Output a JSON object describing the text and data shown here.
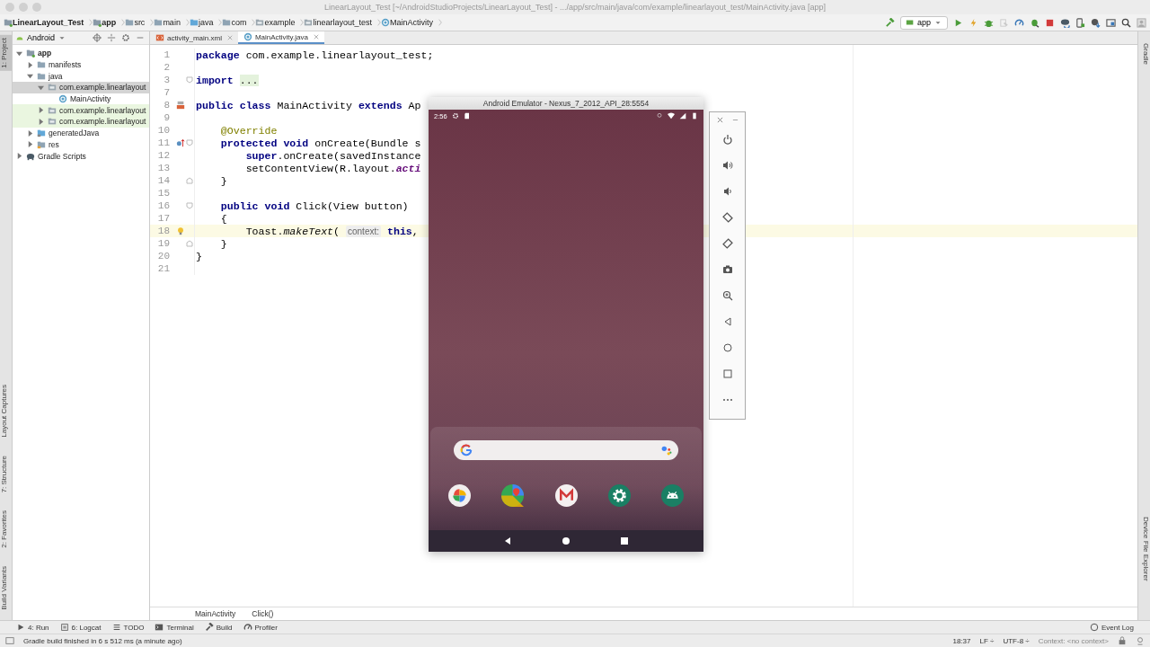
{
  "window": {
    "title": "LinearLayout_Test [~/AndroidStudioProjects/LinearLayout_Test] - .../app/src/main/java/com/example/linearlayout_test/MainActivity.java [app]"
  },
  "breadcrumbs": [
    {
      "label": "LinearLayout_Test",
      "kind": "module",
      "bold": true
    },
    {
      "label": "app",
      "kind": "module",
      "bold": true
    },
    {
      "label": "src",
      "kind": "folder",
      "bold": false
    },
    {
      "label": "main",
      "kind": "folder",
      "bold": false
    },
    {
      "label": "java",
      "kind": "source",
      "bold": false
    },
    {
      "label": "com",
      "kind": "folder",
      "bold": false
    },
    {
      "label": "example",
      "kind": "package",
      "bold": false
    },
    {
      "label": "linearlayout_test",
      "kind": "package",
      "bold": false
    },
    {
      "label": "MainActivity",
      "kind": "class",
      "bold": false
    }
  ],
  "toolbar": {
    "run_config": "app",
    "buttons": [
      {
        "kind": "hammer",
        "disabled": false
      },
      {
        "kind": "run",
        "disabled": false
      },
      {
        "kind": "apply",
        "disabled": false
      },
      {
        "kind": "debug",
        "disabled": false
      },
      {
        "kind": "attach",
        "disabled": true
      },
      {
        "kind": "profile",
        "disabled": false
      },
      {
        "kind": "debugattach",
        "disabled": false
      },
      {
        "kind": "stop",
        "disabled": false
      },
      {
        "kind": "sync",
        "disabled": false
      },
      {
        "kind": "avd",
        "disabled": false
      },
      {
        "kind": "sdk",
        "disabled": false
      },
      {
        "kind": "structure",
        "disabled": false
      },
      {
        "kind": "search",
        "disabled": false
      },
      {
        "kind": "account",
        "disabled": false
      }
    ]
  },
  "left_stripe": {
    "top": [
      {
        "label": "1: Project",
        "selected": true
      }
    ],
    "bottom": [
      {
        "label": "Layout Captures",
        "selected": false
      },
      {
        "label": "7: Structure",
        "selected": false
      },
      {
        "label": "2: Favorites",
        "selected": false
      },
      {
        "label": "Build Variants",
        "selected": false
      }
    ]
  },
  "right_stripe": {
    "top": [
      {
        "label": "Gradle"
      }
    ],
    "bottom": [
      {
        "label": "Device File Explorer"
      }
    ]
  },
  "project": {
    "view": "Android",
    "tree": [
      {
        "label": "app",
        "kind": "module",
        "bold": true,
        "expanded": true,
        "selected": false,
        "tinted": false,
        "children": [
          {
            "label": "manifests",
            "kind": "folder",
            "bold": false,
            "expanded": false,
            "selected": false,
            "tinted": false
          },
          {
            "label": "java",
            "kind": "folder",
            "bold": false,
            "expanded": true,
            "selected": false,
            "tinted": false,
            "children": [
              {
                "label": "com.example.linearlayout",
                "kind": "package",
                "bold": false,
                "expanded": true,
                "selected": true,
                "tinted": false,
                "children": [
                  {
                    "label": "MainActivity",
                    "kind": "class",
                    "bold": false,
                    "selected": false,
                    "tinted": false
                  }
                ]
              },
              {
                "label": "com.example.linearlayout",
                "kind": "package",
                "bold": false,
                "expanded": false,
                "selected": false,
                "tinted": true
              },
              {
                "label": "com.example.linearlayout",
                "kind": "package",
                "bold": false,
                "expanded": false,
                "selected": false,
                "tinted": true
              }
            ]
          },
          {
            "label": "generatedJava",
            "kind": "generated",
            "bold": false,
            "expanded": false,
            "selected": false,
            "tinted": false
          },
          {
            "label": "res",
            "kind": "res",
            "bold": false,
            "expanded": false,
            "selected": false,
            "tinted": false
          }
        ]
      },
      {
        "label": "Gradle Scripts",
        "kind": "gradle",
        "bold": false,
        "expanded": false,
        "selected": false,
        "tinted": false
      }
    ]
  },
  "editor": {
    "tabs": [
      {
        "label": "activity_main.xml",
        "kind": "xml",
        "selected": false
      },
      {
        "label": "MainActivity.java",
        "kind": "class",
        "selected": true
      }
    ],
    "lines": [
      {
        "number": "1",
        "segments": [
          {
            "text": "package",
            "kind": "keyword"
          },
          {
            "text": " com.example.linearlayout_test;",
            "kind": "plain"
          }
        ]
      },
      {
        "number": "2"
      },
      {
        "number": "3",
        "fold": {
          "kind": "start"
        },
        "segments": [
          {
            "text": "import ",
            "kind": "keyword"
          },
          {
            "text": "...",
            "kind": "folded"
          }
        ]
      },
      {
        "number": "7"
      },
      {
        "number": "8",
        "marker": {
          "kind": "layout"
        },
        "segments": [
          {
            "text": "public class",
            "kind": "keyword"
          },
          {
            "text": " MainActivity ",
            "kind": "plain"
          },
          {
            "text": "extends",
            "kind": "keyword"
          },
          {
            "text": " Ap",
            "kind": "plain"
          }
        ]
      },
      {
        "number": "9"
      },
      {
        "number": "10",
        "segments": [
          {
            "text": "    @Override",
            "kind": "annotation"
          }
        ]
      },
      {
        "number": "11",
        "marker": {
          "kind": "override"
        },
        "fold": {
          "kind": "start"
        },
        "segments": [
          {
            "text": "    protected void",
            "kind": "keyword"
          },
          {
            "text": " onCreate(Bundle s",
            "kind": "plain"
          }
        ]
      },
      {
        "number": "12",
        "segments": [
          {
            "text": "        super",
            "kind": "keyword"
          },
          {
            "text": ".onCreate(savedInstance",
            "kind": "plain"
          }
        ]
      },
      {
        "number": "13",
        "segments": [
          {
            "text": "        setContentView(R.layout.",
            "kind": "plain"
          },
          {
            "text": "acti",
            "kind": "field"
          }
        ]
      },
      {
        "number": "14",
        "fold": {
          "kind": "end"
        },
        "segments": [
          {
            "text": "    }",
            "kind": "plain"
          }
        ]
      },
      {
        "number": "15"
      },
      {
        "number": "16",
        "fold": {
          "kind": "start"
        },
        "segments": [
          {
            "text": "    public void",
            "kind": "keyword"
          },
          {
            "text": " Click(View button)",
            "kind": "plain"
          }
        ]
      },
      {
        "number": "17",
        "segments": [
          {
            "text": "    {",
            "kind": "plain"
          }
        ]
      },
      {
        "number": "18",
        "marker": {
          "kind": "bulb"
        },
        "highlighted": true,
        "segments": [
          {
            "text": "        Toast.",
            "kind": "plain"
          },
          {
            "text": "makeText",
            "kind": "italic"
          },
          {
            "text": "( ",
            "kind": "plain"
          },
          {
            "text": "context:",
            "kind": "hint"
          },
          {
            "text": " this",
            "kind": "keyword"
          },
          {
            "text": ",",
            "kind": "plain"
          }
        ]
      },
      {
        "number": "19",
        "fold": {
          "kind": "end"
        },
        "segments": [
          {
            "text": "    }",
            "kind": "plain"
          }
        ]
      },
      {
        "number": "20",
        "segments": [
          {
            "text": "}",
            "kind": "plain"
          }
        ]
      },
      {
        "number": "21"
      }
    ],
    "breadcrumb": [
      "MainActivity",
      "Click()"
    ]
  },
  "emulator": {
    "title": "Android Emulator - Nexus_7_2012_API_28:5554",
    "time": "2:56",
    "dock": [
      {
        "kind": "photos"
      },
      {
        "kind": "maps"
      },
      {
        "kind": "gmail"
      },
      {
        "kind": "settings"
      },
      {
        "kind": "android"
      }
    ],
    "controls": [
      {
        "kind": "power"
      },
      {
        "kind": "volup"
      },
      {
        "kind": "voldown"
      },
      {
        "kind": "rotleft"
      },
      {
        "kind": "rotright"
      },
      {
        "kind": "camera"
      },
      {
        "kind": "zoom"
      },
      {
        "kind": "back"
      },
      {
        "kind": "home"
      },
      {
        "kind": "overview"
      },
      {
        "kind": "more"
      }
    ]
  },
  "tool_windows": {
    "left": [
      {
        "label": "4: Run",
        "kind": "run"
      },
      {
        "label": "6: Logcat",
        "kind": "logcat"
      },
      {
        "label": "TODO",
        "kind": "todo"
      },
      {
        "label": "Terminal",
        "kind": "terminal"
      },
      {
        "label": "Build",
        "kind": "build"
      },
      {
        "label": "Profiler",
        "kind": "profiler"
      }
    ],
    "right": [
      {
        "label": "Event Log",
        "kind": "log"
      }
    ]
  },
  "status_bar": {
    "message": "Gradle build finished in 6 s 512 ms (a minute ago)",
    "position": "18:37",
    "line_separator": "LF ÷",
    "encoding": "UTF-8 ÷",
    "context": "Context: <no context>"
  }
}
